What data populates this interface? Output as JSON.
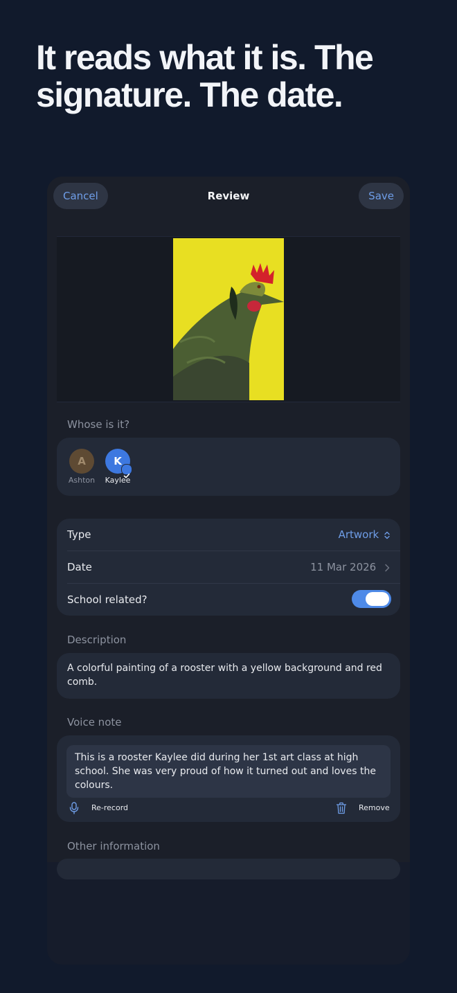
{
  "headline": "It reads what it is. The signature. The date.",
  "nav": {
    "cancel": "Cancel",
    "title": "Review",
    "save": "Save"
  },
  "artwork": {
    "subject": "rooster painting",
    "background_color": "#e9e020"
  },
  "owner": {
    "label": "Whose is it?",
    "people": [
      {
        "initial": "A",
        "name": "Ashton",
        "selected": false,
        "color": "#5e4a33"
      },
      {
        "initial": "K",
        "name": "Kaylee",
        "selected": true,
        "color": "#3d78e0"
      }
    ]
  },
  "details": {
    "type_label": "Type",
    "type_value": "Artwork",
    "date_label": "Date",
    "date_value": "11 Mar 2026",
    "school_label": "School related?",
    "school_on": true
  },
  "description": {
    "label": "Description",
    "text": "A colorful painting of a rooster with a yellow background and red comb."
  },
  "voice_note": {
    "label": "Voice note",
    "transcript": "This is a rooster Kaylee did during her 1st art class at high school. She was very proud of how it turned out and loves the colours.",
    "rerecord": "Re-record",
    "remove": "Remove"
  },
  "other": {
    "label": "Other information"
  },
  "colors": {
    "page_background": "#111a2c",
    "screen_background": "#1b1f29",
    "card": "#232a38",
    "accent": "#4e8ae8",
    "link": "#6f9ee8"
  },
  "icons": {
    "type_chevron": "chevron-up-down-icon",
    "date_chevron": "chevron-right-icon",
    "check": "checkmark-icon",
    "mic": "microphone-icon",
    "trash": "trash-icon"
  }
}
